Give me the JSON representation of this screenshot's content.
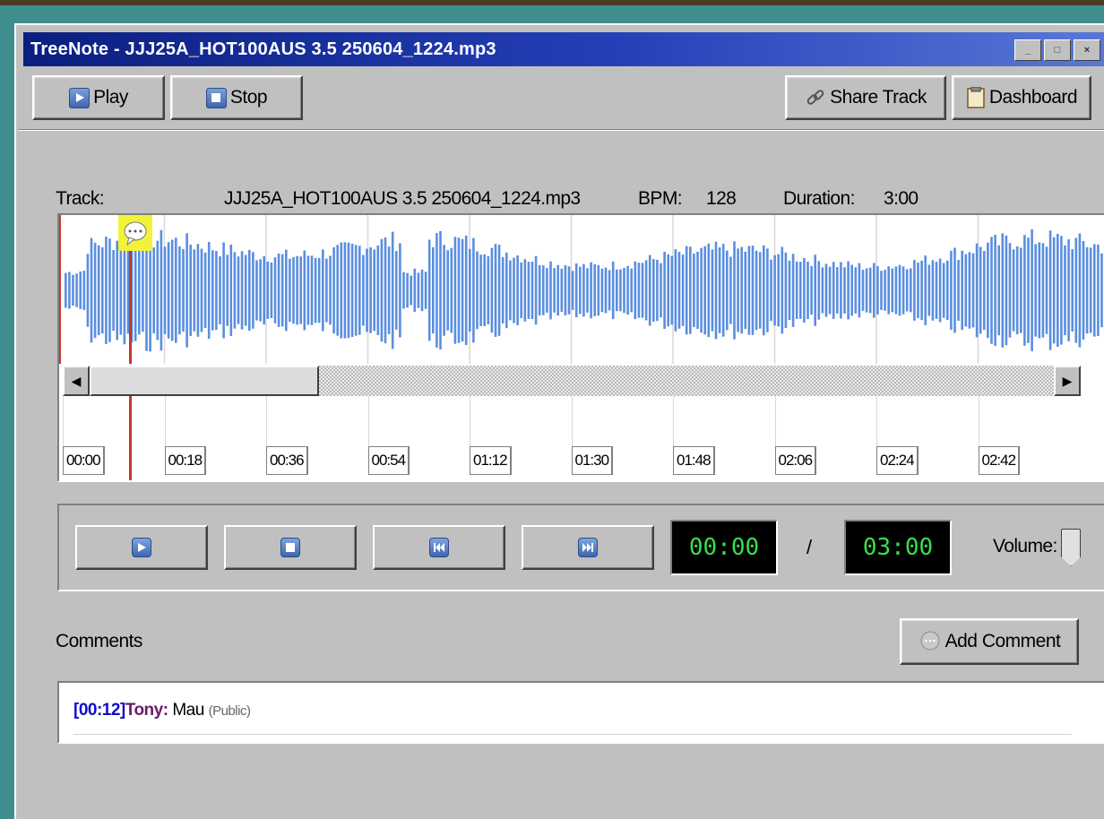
{
  "window": {
    "title": "TreeNote - JJJ25A_HOT100AUS 3.5 250604_1224.mp3",
    "controls": [
      "minimize",
      "maximize",
      "close"
    ]
  },
  "toolbar": {
    "play_label": "Play",
    "stop_label": "Stop",
    "share_label": "Share Track",
    "dashboard_label": "Dashboard"
  },
  "track_info": {
    "track_label": "Track:",
    "track_value": "JJJ25A_HOT100AUS 3.5 250604_1224.mp3",
    "bpm_label": "BPM:",
    "bpm_value": "128",
    "duration_label": "Duration:",
    "duration_value": "3:00"
  },
  "waveform": {
    "color": "#5a8ee0",
    "playhead_color": "#c0392b",
    "comment_marker_color": "#f2f23a",
    "timeline_ticks": [
      "00:00",
      "00:18",
      "00:36",
      "00:54",
      "01:12",
      "01:30",
      "01:48",
      "02:06",
      "02:24",
      "02:42"
    ],
    "scroll_position": 0.0
  },
  "transport": {
    "buttons": [
      "play-icon",
      "stop-icon",
      "rewind-icon",
      "fast-forward-icon"
    ],
    "current_time": "00:00",
    "separator": "/",
    "total_time": "03:00",
    "volume_label": "Volume:"
  },
  "comments": {
    "section_label": "Comments",
    "add_label": "Add Comment",
    "items": [
      {
        "time": "[00:12]",
        "user": "Tony:",
        "text": "Mau",
        "visibility": "(Public)"
      }
    ]
  }
}
